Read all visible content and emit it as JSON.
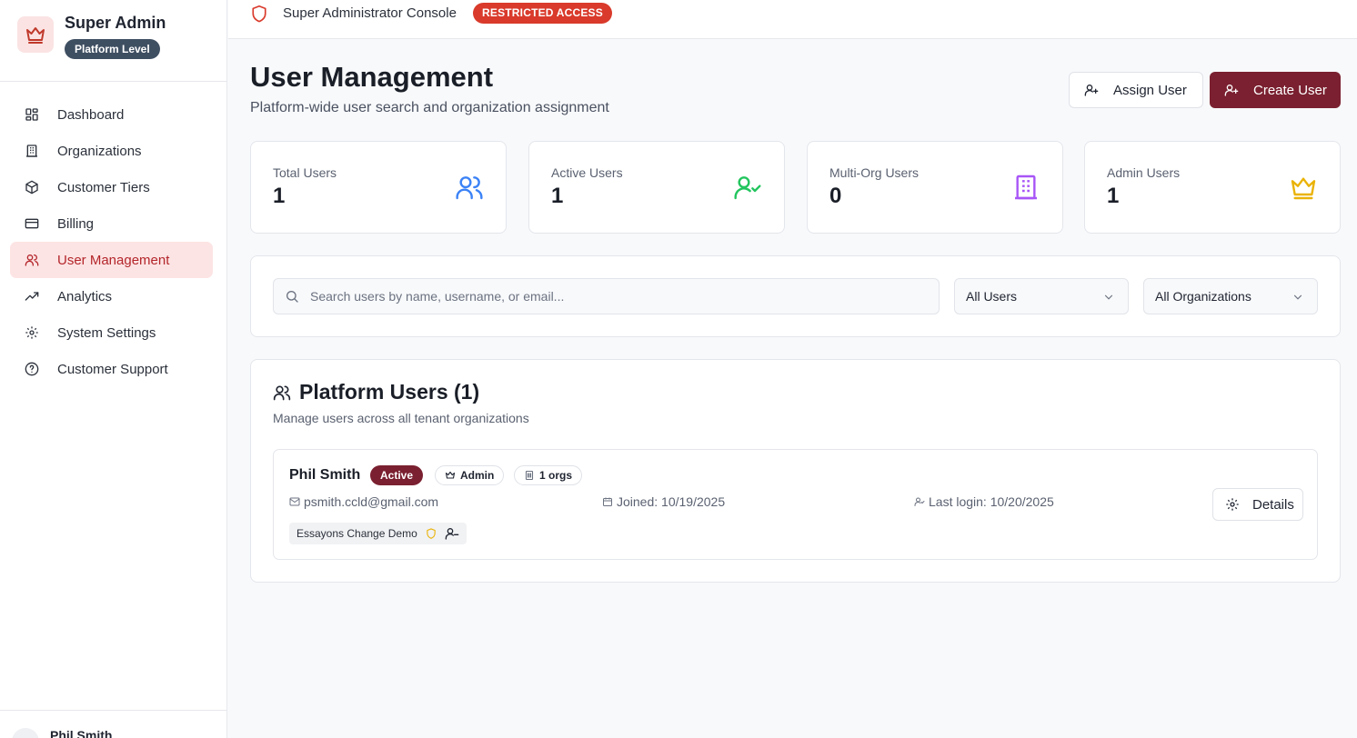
{
  "sidebar": {
    "title": "Super Admin",
    "badge": "Platform Level",
    "items": [
      {
        "label": "Dashboard",
        "icon": "dashboard-icon"
      },
      {
        "label": "Organizations",
        "icon": "building-icon"
      },
      {
        "label": "Customer Tiers",
        "icon": "package-icon"
      },
      {
        "label": "Billing",
        "icon": "credit-card-icon"
      },
      {
        "label": "User Management",
        "icon": "users-icon",
        "active": true
      },
      {
        "label": "Analytics",
        "icon": "trending-up-icon"
      },
      {
        "label": "System Settings",
        "icon": "gear-icon"
      },
      {
        "label": "Customer Support",
        "icon": "help-circle-icon"
      }
    ],
    "footer_user": "Phil Smith"
  },
  "topbar": {
    "console_label": "Super Administrator Console",
    "restricted_badge": "RESTRICTED ACCESS"
  },
  "header": {
    "title": "User Management",
    "subtitle": "Platform-wide user search and organization assignment",
    "assign_label": "Assign User",
    "create_label": "Create User"
  },
  "stats": [
    {
      "label": "Total Users",
      "value": "1",
      "icon": "users-icon",
      "color": "#3b82f6"
    },
    {
      "label": "Active Users",
      "value": "1",
      "icon": "user-check-icon",
      "color": "#22c55e"
    },
    {
      "label": "Multi-Org Users",
      "value": "0",
      "icon": "building-icon",
      "color": "#a855f7"
    },
    {
      "label": "Admin Users",
      "value": "1",
      "icon": "crown-icon",
      "color": "#eab308"
    }
  ],
  "filters": {
    "search_placeholder": "Search users by name, username, or email...",
    "status_select": "All Users",
    "org_select": "All Organizations"
  },
  "users_panel": {
    "title": "Platform Users (1)",
    "subtitle": "Manage users across all tenant organizations",
    "rows": [
      {
        "name": "Phil Smith",
        "status": "Active",
        "role": "Admin",
        "orgs": "1 orgs",
        "email": "psmith.ccld@gmail.com",
        "joined": "Joined: 10/19/2025",
        "last_login": "Last login: 10/20/2025",
        "org_chip": "Essayons Change Demo",
        "details_label": "Details"
      }
    ]
  },
  "colors": {
    "brand": "#7a2030",
    "danger": "#d93a2b",
    "active_nav_bg": "#fde4e4",
    "active_nav_text": "#b3262b"
  }
}
